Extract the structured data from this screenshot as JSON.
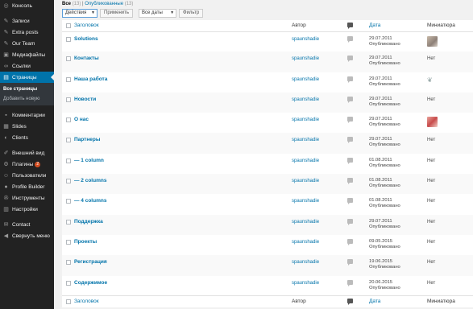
{
  "sidebar": {
    "items": [
      {
        "label": "Консоль",
        "icon": "dashboard-icon",
        "glyph": "◎"
      },
      {
        "label": "Записи",
        "icon": "pin-icon",
        "glyph": "✎"
      },
      {
        "label": "Extra posts",
        "icon": "pin-icon",
        "glyph": "✎"
      },
      {
        "label": "Our Team",
        "icon": "pin-icon",
        "glyph": "✎"
      },
      {
        "label": "Медиафайлы",
        "icon": "media-icon",
        "glyph": "▣"
      },
      {
        "label": "Ссылки",
        "icon": "links-icon",
        "glyph": "∞"
      },
      {
        "label": "Страницы",
        "icon": "pages-icon",
        "glyph": "▤"
      }
    ],
    "submenu": [
      "Все страницы",
      "Добавить новую"
    ],
    "items2": [
      {
        "label": "Комментарии",
        "icon": "comments-icon",
        "glyph": "▪"
      },
      {
        "label": "Slides",
        "icon": "slides-icon",
        "glyph": "▦"
      },
      {
        "label": "Clients",
        "icon": "clients-icon",
        "glyph": "◐"
      }
    ],
    "items3": [
      {
        "label": "Внешний вид",
        "icon": "appearance-icon",
        "glyph": "✐"
      },
      {
        "label": "Плагины",
        "icon": "plugins-icon",
        "glyph": "⚙",
        "badge": "2"
      },
      {
        "label": "Пользователи",
        "icon": "users-icon",
        "glyph": "☺"
      },
      {
        "label": "Profile Builder",
        "icon": "profile-builder-icon",
        "glyph": "●"
      },
      {
        "label": "Инструменты",
        "icon": "tools-icon",
        "glyph": "✇"
      },
      {
        "label": "Настройки",
        "icon": "settings-icon",
        "glyph": "▥"
      }
    ],
    "items4": [
      {
        "label": "Contact",
        "icon": "contact-icon",
        "glyph": "✉"
      },
      {
        "label": "Свернуть меню",
        "icon": "collapse-icon",
        "glyph": "◀"
      }
    ]
  },
  "filters": {
    "all_label": "Все",
    "all_count": "(13)",
    "sep": "|",
    "published_label": "Опубликованные",
    "published_count": "(13)"
  },
  "toolbar": {
    "bulk_action": "Действия",
    "apply": "Применить",
    "dates": "Все даты",
    "filter": "Фильтр"
  },
  "table": {
    "columns": {
      "title": "Заголовок",
      "author": "Автор",
      "date": "Дата",
      "thumb": "Миниатюра"
    },
    "rows": [
      {
        "title": "Solutions",
        "author": "spaunshadie",
        "date": "29.07.2011",
        "status": "Опубликовано",
        "thumb": "image"
      },
      {
        "title": "Контакты",
        "author": "spaunshadie",
        "date": "29.07.2011",
        "status": "Опубликовано",
        "thumb": "Нет"
      },
      {
        "title": "Наша работа",
        "author": "spaunshadie",
        "date": "29.07.2011",
        "status": "Опубликовано",
        "thumb": "leaf"
      },
      {
        "title": "Новости",
        "author": "spaunshadie",
        "date": "29.07.2011",
        "status": "Опубликовано",
        "thumb": "Нет"
      },
      {
        "title": "О нас",
        "author": "spaunshadie",
        "date": "29.07.2011",
        "status": "Опубликовано",
        "thumb": "image2"
      },
      {
        "title": "Партнеры",
        "author": "spaunshadie",
        "date": "29.07.2011",
        "status": "Опубликовано",
        "thumb": "Нет"
      },
      {
        "title": "— 1 column",
        "author": "spaunshadie",
        "date": "01.08.2011",
        "status": "Опубликовано",
        "thumb": "Нет"
      },
      {
        "title": "— 2 columns",
        "author": "spaunshadie",
        "date": "01.08.2011",
        "status": "Опубликовано",
        "thumb": "Нет"
      },
      {
        "title": "— 4 columns",
        "author": "spaunshadie",
        "date": "01.08.2011",
        "status": "Опубликовано",
        "thumb": "Нет"
      },
      {
        "title": "Поддержка",
        "author": "spaunshadie",
        "date": "29.07.2011",
        "status": "Опубликовано",
        "thumb": "Нет"
      },
      {
        "title": "Проекты",
        "author": "spaunshadie",
        "date": "09.05.2015",
        "status": "Опубликовано",
        "thumb": "Нет"
      },
      {
        "title": "Регистрация",
        "author": "spaunshadie",
        "date": "19.06.2015",
        "status": "Опубликовано",
        "thumb": "Нет"
      },
      {
        "title": "Содержимое",
        "author": "spaunshadie",
        "date": "20.06.2015",
        "status": "Опубликовано",
        "thumb": "Нет"
      }
    ]
  }
}
